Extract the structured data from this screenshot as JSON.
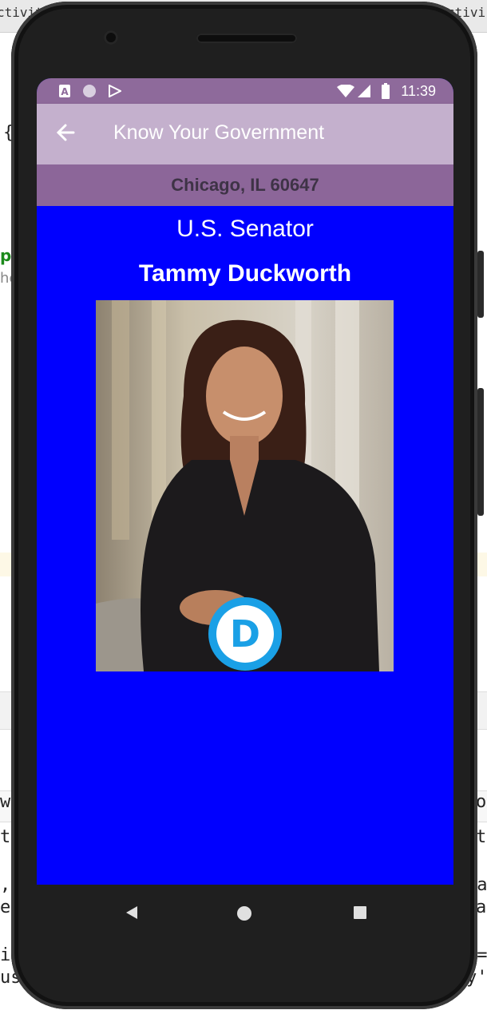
{
  "ide": {
    "tab_left": "ctivit",
    "tab_right": "ctivi",
    "code_fragments": [
      "{",
      "p",
      "he",
      "w",
      "t",
      ",",
      "es",
      "i",
      "us",
      "o",
      "t",
      "ra",
      "a",
      "k=",
      "y'"
    ]
  },
  "status_bar": {
    "time": "11:39",
    "icons": [
      "a-badge-icon",
      "circle-icon",
      "play-store-icon",
      "wifi-icon",
      "signal-icon",
      "battery-icon"
    ]
  },
  "app_bar": {
    "title": "Know Your Government",
    "back_icon": "arrow-back-icon"
  },
  "location": {
    "text": "Chicago, IL 60647"
  },
  "official": {
    "office": "U.S. Senator",
    "name": "Tammy Duckworth",
    "party_logo_letter": "D",
    "party_color": "#1aa0e6"
  },
  "nav_bar": {
    "icons": [
      "nav-back-icon",
      "nav-home-icon",
      "nav-recents-icon"
    ]
  },
  "colors": {
    "screen_background": "#0000ff",
    "status_bar": "#8e6a9b",
    "app_bar": "#c4b0cd",
    "location_bar": "#8c6699"
  }
}
